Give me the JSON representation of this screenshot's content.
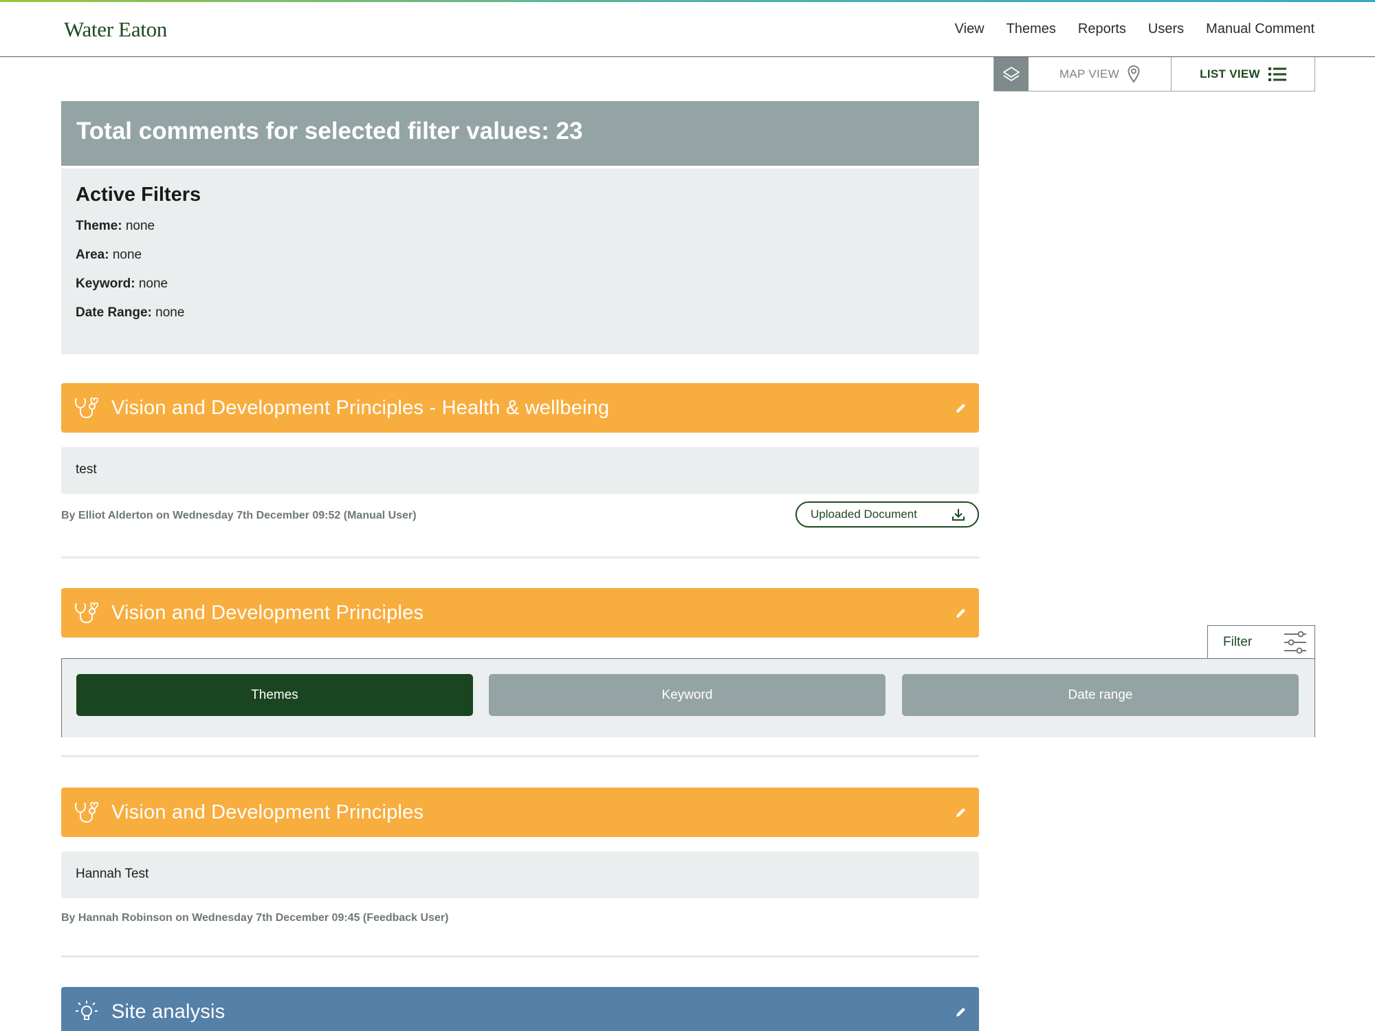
{
  "header": {
    "brand": "Water Eaton",
    "nav": [
      "View",
      "Themes",
      "Reports",
      "Users",
      "Manual Comment"
    ]
  },
  "view_toggle": {
    "layers_icon": "layers-icon",
    "map_label": "MAP VIEW",
    "list_label": "LIST VIEW",
    "active": "LIST VIEW"
  },
  "summary": {
    "total_label": "Total comments for selected filter values: 23"
  },
  "active_filters": {
    "title": "Active Filters",
    "rows": [
      {
        "label": "Theme:",
        "value": "none"
      },
      {
        "label": "Area:",
        "value": "none"
      },
      {
        "label": "Keyword:",
        "value": "none"
      },
      {
        "label": "Date Range:",
        "value": "none"
      }
    ]
  },
  "comments": [
    {
      "theme": "Vision and Development Principles - Health & wellbeing",
      "theme_color": "#f8ad3f",
      "theme_icon": "stethoscope-icon",
      "text": "test",
      "byline": "By Elliot Alderton on Wednesday 7th December 09:52 (Manual User)",
      "attachment": "Uploaded Document"
    },
    {
      "theme": "Vision and Development Principles",
      "theme_color": "#f8ad3f",
      "theme_icon": "stethoscope-icon"
    },
    {
      "theme": "Vision and Development Principles",
      "theme_color": "#f8ad3f",
      "theme_icon": "stethoscope-icon",
      "text": "Hannah Test",
      "byline": "By Hannah Robinson on Wednesday 7th December 09:45 (Feedback User)"
    },
    {
      "theme": "Site analysis",
      "theme_color": "#5580a8",
      "theme_icon": "lightbulb-icon"
    }
  ],
  "filter_panel": {
    "tab_label": "Filter",
    "buttons": [
      "Themes",
      "Keyword",
      "Date range"
    ],
    "active": "Themes"
  }
}
